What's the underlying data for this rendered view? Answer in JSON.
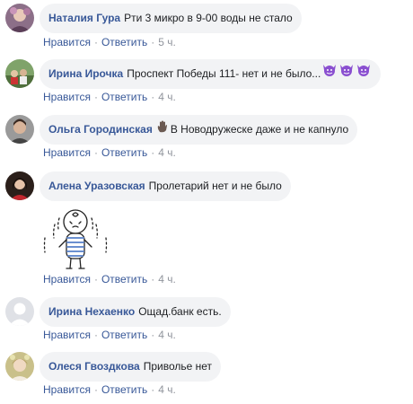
{
  "actions": {
    "like": "Нравится",
    "reply": "Ответить",
    "separator": "·"
  },
  "comments": [
    {
      "author": "Наталия Гура",
      "text": "Рти 3 микро в 9-00 воды не стало",
      "time": "5 ч.",
      "avatar": "avatar-photo"
    },
    {
      "author": "Ирина Ирочка",
      "text": "Проспект Победы 111- нет и не было...",
      "emoji": [
        "devil-icon",
        "devil-icon",
        "devil-icon"
      ],
      "time": "4 ч.",
      "avatar": "avatar-photo"
    },
    {
      "author": "Ольга Городинская",
      "text": "В Новодружеске даже и не капнуло",
      "emoji": [
        "waving-hand-icon"
      ],
      "time": "4 ч.",
      "avatar": "avatar-photo"
    },
    {
      "author": "Алена Уразовская",
      "text": "Пролетарий нет и не было",
      "sticker": "crying-character-sticker",
      "time": "4 ч.",
      "avatar": "avatar-photo"
    },
    {
      "author": "Ирина Нехаенко",
      "text": "Ощад.банк есть.",
      "time": "4 ч.",
      "avatar": "default-avatar"
    },
    {
      "author": "Олеся Гвоздкова",
      "text": "Приволье нет",
      "time": "4 ч.",
      "avatar": "avatar-photo"
    }
  ],
  "colors": {
    "author": "#385898",
    "meta": "#90949c",
    "bubble": "#f2f3f5",
    "emoji": "#8a4fd0"
  }
}
